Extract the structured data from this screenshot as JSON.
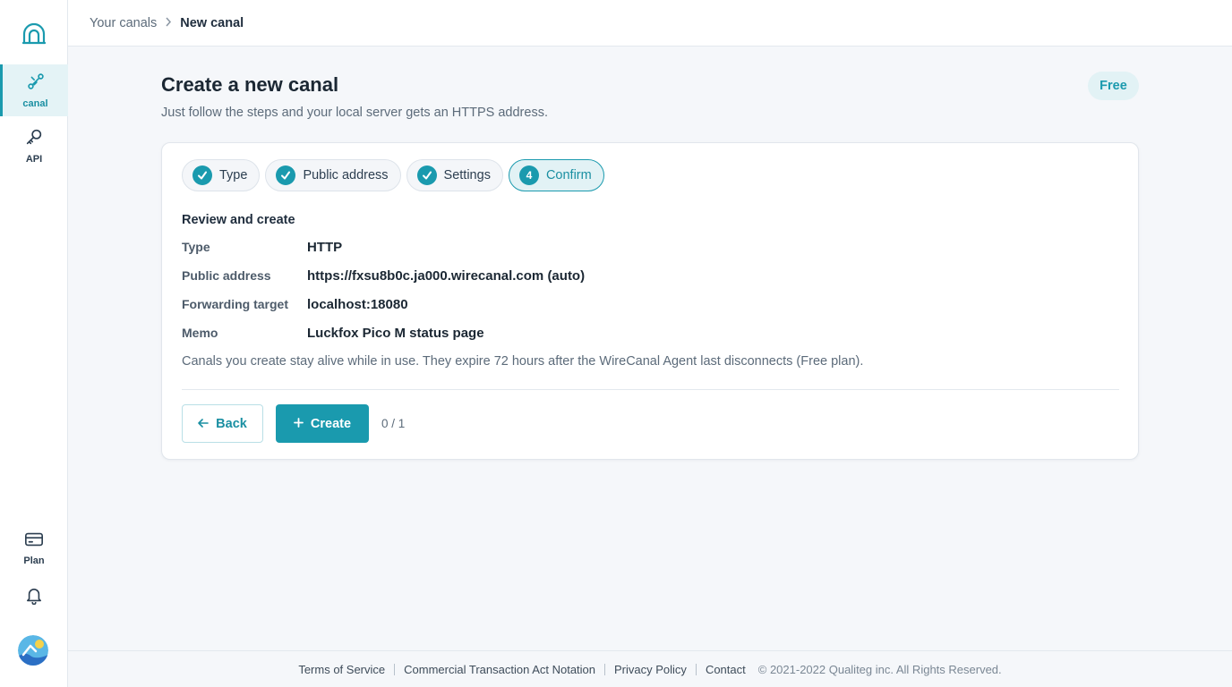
{
  "colors": {
    "accent": "#1a9aae",
    "accent_light": "#e2f2f5",
    "text_dark": "#1b2733",
    "text_muted": "#5c6b7a"
  },
  "sidebar": {
    "logo_icon": "wirecanal-logo-icon",
    "items": [
      {
        "label": "canal",
        "icon": "link-icon",
        "active": true
      },
      {
        "label": "API",
        "icon": "key-icon",
        "active": false
      },
      {
        "label": "Plan",
        "icon": "credit-card-icon",
        "active": false
      }
    ],
    "bell_icon": "bell-icon",
    "avatar_icon": "avatar-image"
  },
  "breadcrumb": {
    "parent": "Your canals",
    "current": "New canal"
  },
  "page": {
    "title": "Create a new canal",
    "subtitle": "Just follow the steps and your local server gets an HTTPS address.",
    "plan_badge": "Free"
  },
  "steps": [
    {
      "label": "Type",
      "status": "done",
      "marker": ""
    },
    {
      "label": "Public address",
      "status": "done",
      "marker": ""
    },
    {
      "label": "Settings",
      "status": "done",
      "marker": ""
    },
    {
      "label": "Confirm",
      "status": "current",
      "marker": "4"
    }
  ],
  "review": {
    "title": "Review and create",
    "rows": [
      {
        "key": "Type",
        "value": "HTTP"
      },
      {
        "key": "Public address",
        "value": "https://fxsu8b0c.ja000.wirecanal.com (auto)"
      },
      {
        "key": "Forwarding target",
        "value": "localhost:18080"
      },
      {
        "key": "Memo",
        "value": "Luckfox Pico M status page"
      }
    ],
    "note": "Canals you create stay alive while in use. They expire 72 hours after the WireCanal Agent last disconnects (Free plan)."
  },
  "actions": {
    "back_label": "Back",
    "create_label": "Create",
    "counter": "0 / 1"
  },
  "footer": {
    "links": [
      "Terms of Service",
      "Commercial Transaction Act Notation",
      "Privacy Policy",
      "Contact"
    ],
    "copyright": "© 2021-2022 Qualiteg inc. All Rights Reserved."
  }
}
